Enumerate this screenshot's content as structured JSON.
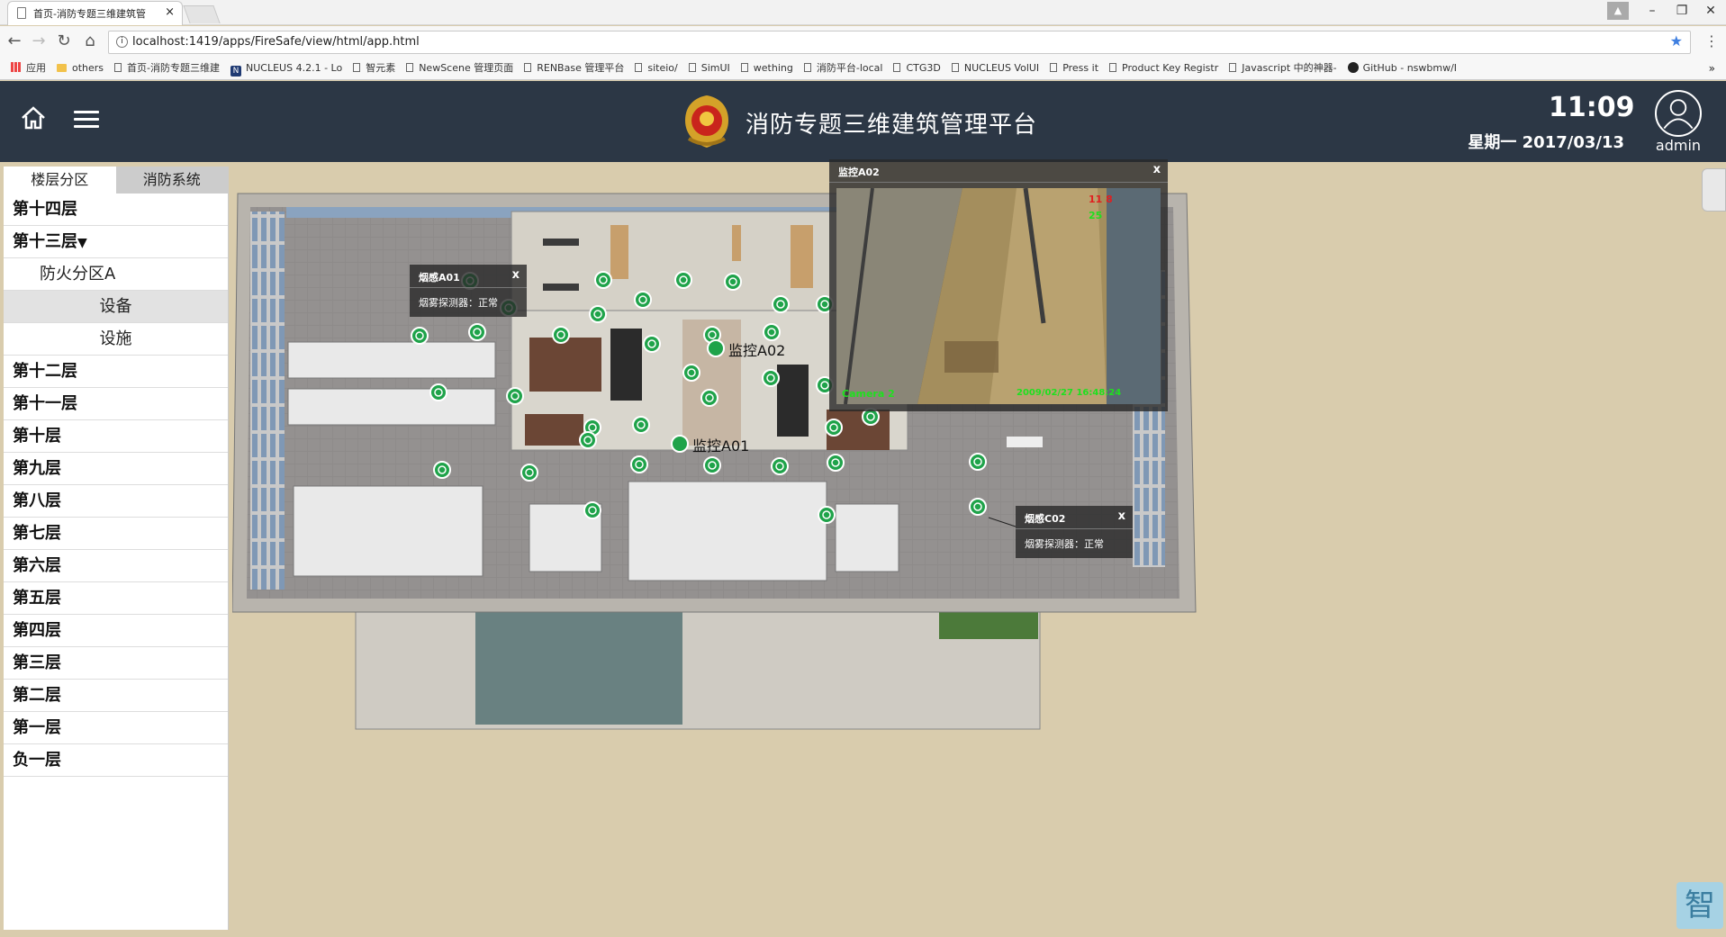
{
  "browser": {
    "tab_title": "首页-消防专题三维建筑管",
    "url": "localhost:1419/apps/FireSafe/view/html/app.html",
    "bookmarks": [
      {
        "label": "应用",
        "icon": "apps-icon"
      },
      {
        "label": "others",
        "icon": "folder-icon"
      },
      {
        "label": "首页-消防专题三维建",
        "icon": "page-icon"
      },
      {
        "label": "NUCLEUS 4.2.1 - Lo",
        "icon": "nucleus-icon"
      },
      {
        "label": "智元素",
        "icon": "page-icon"
      },
      {
        "label": "NewScene 管理页面",
        "icon": "page-icon"
      },
      {
        "label": "RENBase 管理平台",
        "icon": "page-icon"
      },
      {
        "label": "siteio/",
        "icon": "page-icon"
      },
      {
        "label": "SimUI",
        "icon": "page-icon"
      },
      {
        "label": "wething",
        "icon": "page-icon"
      },
      {
        "label": "消防平台-local",
        "icon": "page-icon"
      },
      {
        "label": "CTG3D",
        "icon": "page-icon"
      },
      {
        "label": "NUCLEUS VolUI",
        "icon": "page-icon"
      },
      {
        "label": "Press it",
        "icon": "page-icon"
      },
      {
        "label": "Product Key Registr",
        "icon": "page-icon"
      },
      {
        "label": "Javascript 中的神器-",
        "icon": "page-icon"
      },
      {
        "label": "GitHub - nswbmw/I",
        "icon": "github-icon"
      }
    ]
  },
  "header": {
    "title": "消防专题三维建筑管理平台",
    "time": "11:09",
    "date": "星期一 2017/03/13",
    "user": "admin"
  },
  "sidebar": {
    "tabs": [
      "楼层分区",
      "消防系统"
    ],
    "floors_top": [
      "第十四层"
    ],
    "expanded_floor": "第十三层",
    "zone": "防火分区A",
    "zone_items": [
      "设备",
      "设施"
    ],
    "floors_rest": [
      "第十二层",
      "第十一层",
      "第十层",
      "第九层",
      "第八层",
      "第七层",
      "第六层",
      "第五层",
      "第四层",
      "第三层",
      "第二层",
      "第一层",
      "负一层"
    ]
  },
  "map": {
    "labels": {
      "cam1": "监控A01",
      "cam2": "监控A02"
    },
    "popup_smoke_a01": {
      "title": "烟感A01",
      "body": "烟雾探测器：正常",
      "close": "x"
    },
    "popup_smoke_c02": {
      "title": "烟感C02",
      "body": "烟雾探测器：正常",
      "close": "x"
    },
    "popup_cam_a02": {
      "title": "监控A02",
      "close": "x",
      "camera": "Camera 2",
      "timestamp": "2009/02/27 16:48:24",
      "overlay_red": "11 8",
      "overlay_green": "25"
    }
  },
  "colors": {
    "header_bg": "#2c3745",
    "sensor_green": "#1fa34a",
    "ground": "#d9ccad"
  }
}
